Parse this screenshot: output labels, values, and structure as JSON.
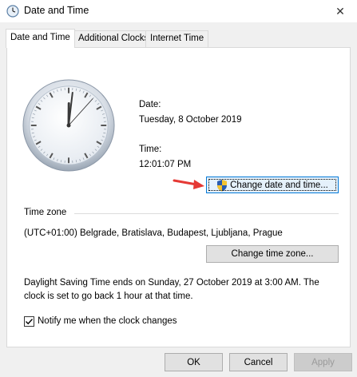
{
  "window": {
    "title": "Date and Time",
    "close_glyph": "✕"
  },
  "tabs": [
    {
      "label": "Date and Time",
      "active": true
    },
    {
      "label": "Additional Clocks",
      "active": false
    },
    {
      "label": "Internet Time",
      "active": false
    }
  ],
  "clock": {
    "hour": 12,
    "minute": 1,
    "second": 7
  },
  "date_section": {
    "date_label": "Date:",
    "date_value": "Tuesday, 8 October 2019",
    "time_label": "Time:",
    "time_value": "12:01:07 PM",
    "change_button": "Change date and time..."
  },
  "timezone": {
    "group_label": "Time zone",
    "value": "(UTC+01:00) Belgrade, Bratislava, Budapest, Ljubljana, Prague",
    "change_button": "Change time zone..."
  },
  "dst": {
    "line1": "Daylight Saving Time ends on Sunday, 27 October 2019 at 3:00 AM. The",
    "line2": "clock is set to go back 1 hour at that time."
  },
  "notify": {
    "label": "Notify me when the clock changes",
    "checked": true
  },
  "footer": {
    "ok": "OK",
    "cancel": "Cancel",
    "apply": "Apply"
  },
  "colors": {
    "arrow": "#e53935",
    "accent": "#0078d7"
  }
}
